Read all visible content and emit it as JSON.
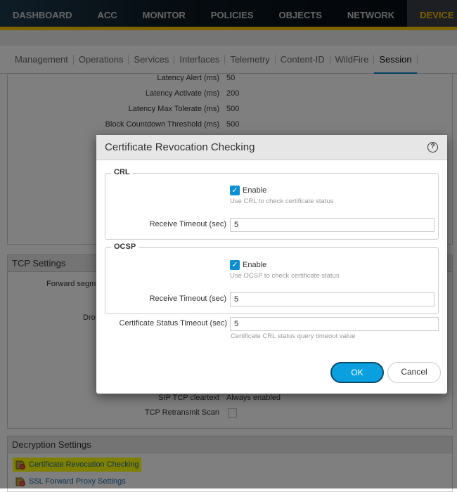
{
  "topnav": [
    "DASHBOARD",
    "ACC",
    "MONITOR",
    "POLICIES",
    "OBJECTS",
    "NETWORK",
    "DEVICE"
  ],
  "subtabs": [
    "Management",
    "Operations",
    "Services",
    "Interfaces",
    "Telemetry",
    "Content-ID",
    "WildFire",
    "Session"
  ],
  "session_rows": [
    {
      "label": "Latency Alert (ms)",
      "value": "50"
    },
    {
      "label": "Latency Activate (ms)",
      "value": "200"
    },
    {
      "label": "Latency Max Tolerate (ms)",
      "value": "500"
    },
    {
      "label": "Block Countdown Threshold (ms)",
      "value": "500"
    }
  ],
  "tcp": {
    "title": "TCP Settings",
    "forward_segment_label": "Forward segm",
    "drop_label": "Dro",
    "sip_label": "SIP TCP cleartext",
    "sip_value": "Always enabled",
    "retransmit_label": "TCP Retransmit Scan"
  },
  "decryption": {
    "title": "Decryption Settings",
    "links": [
      "Certificate Revocation Checking",
      "SSL Forward Proxy Settings"
    ]
  },
  "dialog": {
    "title": "Certificate Revocation Checking",
    "help": "?",
    "crl": {
      "legend": "CRL",
      "enable": "Enable",
      "hint": "Use CRL to check certificate status",
      "timeout_label": "Receive Timeout (sec)",
      "timeout_value": "5"
    },
    "ocsp": {
      "legend": "OCSP",
      "enable": "Enable",
      "hint": "Use OCSP to check certificate status",
      "timeout_label": "Receive Timeout (sec)",
      "timeout_value": "5"
    },
    "status_timeout_label": "Certificate Status Timeout (sec)",
    "status_timeout_value": "5",
    "status_timeout_hint": "Certificate CRL status query timeout value",
    "ok": "OK",
    "cancel": "Cancel"
  }
}
